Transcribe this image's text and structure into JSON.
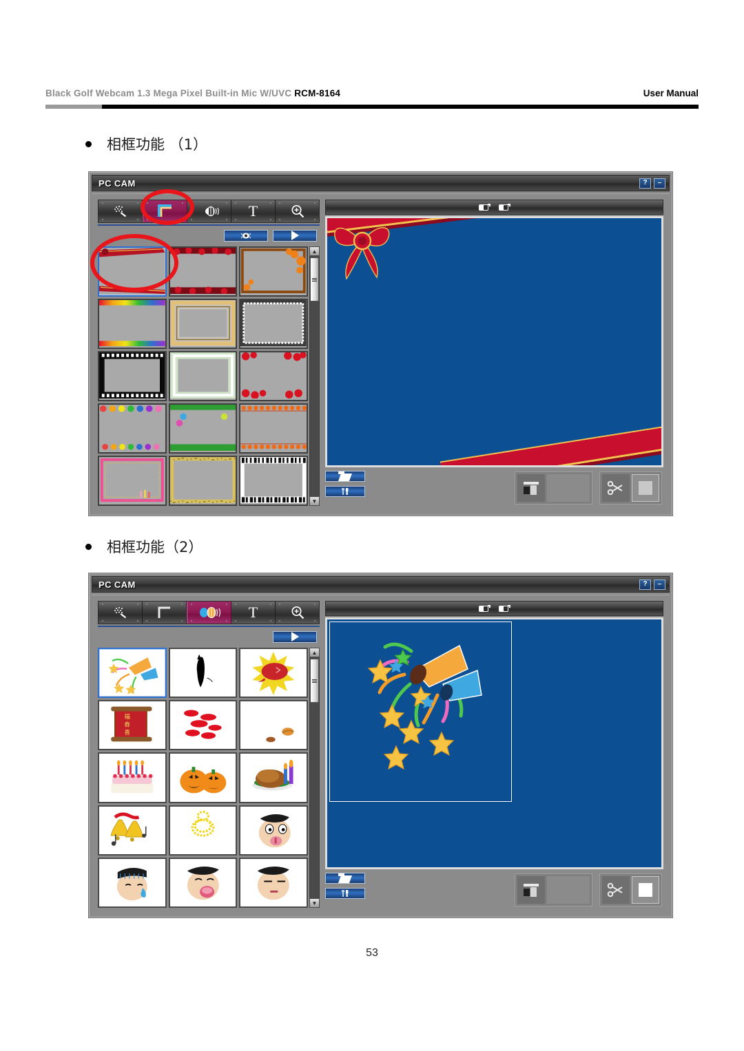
{
  "header": {
    "product_prefix": "Black  Golf  Webcam 1.3 Mega Pixel Built-in Mic W/UVC ",
    "product_model": "RCM-8164",
    "right_label": "User  Manual"
  },
  "page_number": "53",
  "sections": [
    {
      "bullet": "●",
      "title": "相框功能 （1）"
    },
    {
      "bullet": "●",
      "title": "相框功能（2）"
    }
  ],
  "window1": {
    "title": "PC CAM",
    "help_label": "?",
    "minimize_label": "–",
    "toolbar": [
      {
        "name": "effects",
        "glyph": "✨",
        "selected": false
      },
      {
        "name": "frame",
        "glyph": "⌐",
        "selected": true
      },
      {
        "name": "sticker",
        "glyph": "◐",
        "selected": false
      },
      {
        "name": "text",
        "glyph": "T",
        "selected": false
      },
      {
        "name": "zoom",
        "glyph": "⊕",
        "selected": false
      }
    ],
    "sub_buttons": [
      {
        "name": "preview-effect-button",
        "icon": "eye-icon"
      },
      {
        "name": "play-button",
        "icon": "play-icon"
      }
    ],
    "thumbnails": [
      {
        "id": 1,
        "label": "red-ribbon-frame",
        "selected": true
      },
      {
        "id": 2,
        "label": "dark-red-flower-frame",
        "selected": false
      },
      {
        "id": 3,
        "label": "autumn-leaves-frame",
        "selected": false
      },
      {
        "id": 4,
        "label": "rainbow-stripe-frame",
        "selected": false
      },
      {
        "id": 5,
        "label": "gold-ornate-frame",
        "selected": false
      },
      {
        "id": 6,
        "label": "white-dashed-frame",
        "selected": false
      },
      {
        "id": 7,
        "label": "black-filmstrip-frame",
        "selected": false
      },
      {
        "id": 8,
        "label": "green-white-frame",
        "selected": false
      },
      {
        "id": 9,
        "label": "red-roses-frame",
        "selected": false
      },
      {
        "id": 10,
        "label": "balloons-frame",
        "selected": false
      },
      {
        "id": 11,
        "label": "green-grass-frame",
        "selected": false
      },
      {
        "id": 12,
        "label": "orange-stars-frame",
        "selected": false
      },
      {
        "id": 13,
        "label": "pink-candle-frame",
        "selected": false
      },
      {
        "id": 14,
        "label": "gold-speckle-frame",
        "selected": false
      },
      {
        "id": 15,
        "label": "piano-key-frame",
        "selected": false
      }
    ],
    "preview": {
      "background_color": "#0c4f92",
      "overlay": "red-ribbon-bow-frame"
    },
    "bottom": {
      "open_folder": "folder-icon",
      "settings": "tools-icon",
      "split_view": "split-view-icon",
      "grid_cells": [
        false,
        false,
        false,
        false,
        false,
        false,
        false,
        false,
        true
      ],
      "scissors": "scissors-icon",
      "stop_square": "square-icon",
      "stop_active": false
    },
    "annotations": [
      "frame-tool-button",
      "first-frame-thumbnail"
    ]
  },
  "window2": {
    "title": "PC CAM",
    "help_label": "?",
    "minimize_label": "–",
    "toolbar": [
      {
        "name": "effects",
        "glyph": "✨",
        "selected": false
      },
      {
        "name": "frame",
        "glyph": "⌐",
        "selected": false
      },
      {
        "name": "sticker",
        "glyph": "◐",
        "selected": true
      },
      {
        "name": "text",
        "glyph": "T",
        "selected": false
      },
      {
        "name": "zoom",
        "glyph": "⊕",
        "selected": false
      }
    ],
    "sub_buttons": [
      {
        "name": "play-button",
        "icon": "play-icon"
      }
    ],
    "thumbnails": [
      {
        "id": 1,
        "label": "party-popper-confetti",
        "glyph": "🎉",
        "selected": true
      },
      {
        "id": 2,
        "label": "black-cat",
        "glyph": "🐈",
        "selected": false
      },
      {
        "id": 3,
        "label": "red-balloon-starburst",
        "glyph": "🎈",
        "selected": false
      },
      {
        "id": 4,
        "label": "chinese-scroll",
        "glyph": "📜",
        "selected": false
      },
      {
        "id": 5,
        "label": "red-lips-kisses",
        "glyph": "💋",
        "selected": false
      },
      {
        "id": 6,
        "label": "small-leaves",
        "glyph": "🍂",
        "selected": false
      },
      {
        "id": 7,
        "label": "birthday-cake",
        "glyph": "🎂",
        "selected": false
      },
      {
        "id": 8,
        "label": "halloween-pumpkins",
        "glyph": "🎃",
        "selected": false
      },
      {
        "id": 9,
        "label": "roast-turkey",
        "glyph": "🍗",
        "selected": false
      },
      {
        "id": 10,
        "label": "golden-bells",
        "glyph": "🔔",
        "selected": false
      },
      {
        "id": 11,
        "label": "yellow-spiral",
        "glyph": "🌀",
        "selected": false
      },
      {
        "id": 12,
        "label": "face-tongue-out",
        "glyph": "😛",
        "selected": false
      },
      {
        "id": 13,
        "label": "face-crying-tear",
        "glyph": "😢",
        "selected": false
      },
      {
        "id": 14,
        "label": "face-laughing",
        "glyph": "😂",
        "selected": false
      },
      {
        "id": 15,
        "label": "face-sleepy",
        "glyph": "😑",
        "selected": false
      }
    ],
    "preview": {
      "background_color": "#0c4f92",
      "overlay": "party-popper-stars-sticker",
      "selection_box": true
    },
    "bottom": {
      "open_folder": "folder-icon",
      "settings": "tools-icon",
      "split_view": "split-view-icon",
      "grid_cells": [
        false,
        false,
        false,
        false,
        false,
        false,
        false,
        false,
        false
      ],
      "scissors": "scissors-icon",
      "stop_square": "square-icon",
      "stop_active": true
    },
    "annotations": []
  }
}
